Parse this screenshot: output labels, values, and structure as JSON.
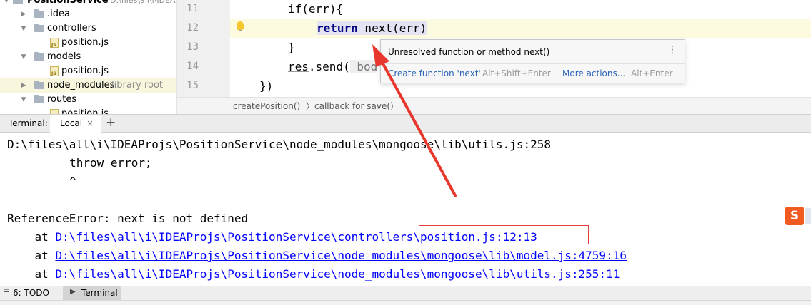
{
  "project_tree": {
    "root": {
      "label": "PositionService",
      "hint": "D:\\files\\all\\i\\IDEAProjs"
    },
    "items": [
      {
        "label": ".idea"
      },
      {
        "label": "controllers"
      },
      {
        "label": "position.js"
      },
      {
        "label": "models"
      },
      {
        "label": "position.js"
      },
      {
        "label": "node_modules",
        "hint": "library root"
      },
      {
        "label": "routes"
      },
      {
        "label": "position.js"
      }
    ]
  },
  "editor": {
    "line_numbers": [
      "11",
      "12",
      "13",
      "14",
      "15"
    ],
    "lines": {
      "l11_a": "if(",
      "l11_b": "err",
      "l11_c": "){",
      "l12_kw": "return",
      "l12_b": " next(",
      "l12_c": "err",
      "l12_d": ")",
      "l13": "}",
      "l14_a": "res",
      "l14_b": ".send(",
      "l14_c": " bod",
      "l15": "})"
    }
  },
  "popup": {
    "message": "Unresolved function or method next()",
    "action1": "Create function 'next'",
    "action1_key": "Alt+Shift+Enter",
    "action2": "More actions...",
    "action2_key": "Alt+Enter"
  },
  "breadcrumb": {
    "item1": "createPosition()",
    "sep": "〉",
    "item2": "callback for save()"
  },
  "terminal": {
    "label": "Terminal:",
    "tab": "Local",
    "close": "×",
    "add": "+",
    "lines": {
      "l1": "D:\\files\\all\\i\\IDEAProjs\\PositionService\\node_modules\\mongoose\\lib\\utils.js:258",
      "l2": "        throw error;",
      "l3": "        ^",
      "l4": "ReferenceError: next is not defined",
      "at": "    at ",
      "link1": "D:\\files\\all\\i\\IDEAProjs\\PositionService\\controllers\\position.js:12:13",
      "link2": "D:\\files\\all\\i\\IDEAProjs\\PositionService\\node_modules\\mongoose\\lib\\model.js:4759:16",
      "link3": "D:\\files\\all\\i\\IDEAProjs\\PositionService\\node_modules\\mongoose\\lib\\utils.js:255:11"
    }
  },
  "bottom_bar": {
    "todo": "6: TODO",
    "terminal": "Terminal"
  },
  "tray": {
    "sogou": "S"
  },
  "colors": {
    "accent_link": "#0000ff",
    "arrow_red": "#e8372c",
    "keyword": "#000080"
  }
}
